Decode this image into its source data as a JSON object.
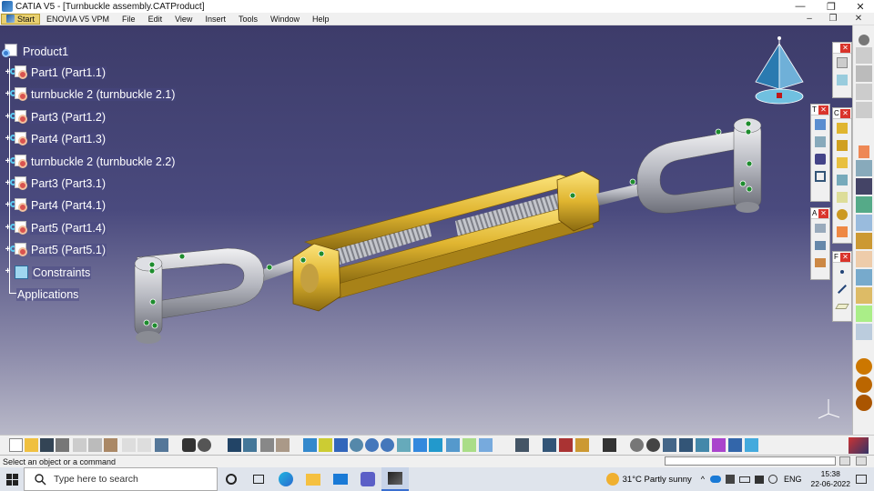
{
  "window": {
    "title": "CATIA V5 - [Turnbuckle assembly.CATProduct]",
    "controls": [
      "—",
      "❐",
      "✕"
    ]
  },
  "menubar": {
    "items": [
      "Start",
      "ENOVIA V5 VPM",
      "File",
      "Edit",
      "View",
      "Insert",
      "Tools",
      "Window",
      "Help"
    ]
  },
  "tree": {
    "root": "Product1",
    "nodes": [
      "Part1 (Part1.1)",
      "turnbuckle 2 (turnbuckle 2.1)",
      "Part3 (Part1.2)",
      "Part4 (Part1.3)",
      "turnbuckle 2 (turnbuckle 2.2)",
      "Part3 (Part3.1)",
      "Part4 (Part4.1)",
      "Part5 (Part1.4)",
      "Part5 (Part5.1)"
    ],
    "constraints": "Constraints",
    "applications": "Applications"
  },
  "toolbars": {
    "t1_letter": "T",
    "t2_letter": "C",
    "t3_letter": "A",
    "t4_letter": "F"
  },
  "status": {
    "message": "Select an object or a command"
  },
  "taskbar": {
    "search_placeholder": "Type here to search",
    "weather": "31°C  Partly sunny",
    "lang": "ENG",
    "time": "15:38",
    "date": "22-06-2022"
  },
  "colors": {
    "viewport_top": "#3d3c6a",
    "viewport_bottom": "#b8b8c8",
    "brass": "#e0b530",
    "steel": "#c0c2c8"
  }
}
